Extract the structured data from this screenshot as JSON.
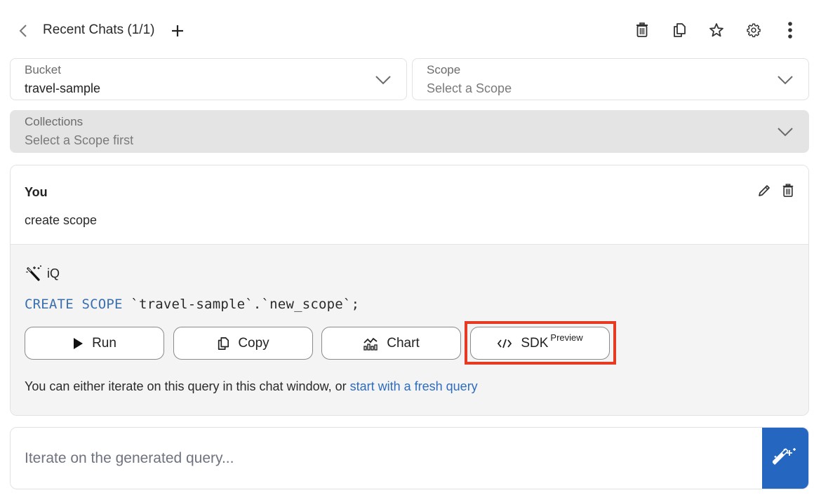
{
  "header": {
    "title": "Recent Chats (1/1)",
    "back_icon": "chevron-left-icon",
    "add_icon": "plus-icon",
    "toolbar": [
      {
        "name": "delete",
        "icon": "trash-icon"
      },
      {
        "name": "copy",
        "icon": "copy-icon"
      },
      {
        "name": "favorite",
        "icon": "star-icon"
      },
      {
        "name": "settings",
        "icon": "gear-icon"
      },
      {
        "name": "more",
        "icon": "more-vertical-icon"
      }
    ]
  },
  "selectors": {
    "bucket": {
      "label": "Bucket",
      "value": "travel-sample"
    },
    "scope": {
      "label": "Scope",
      "placeholder": "Select a Scope"
    },
    "collections": {
      "label": "Collections",
      "placeholder": "Select a Scope first",
      "disabled": true
    }
  },
  "chat": {
    "user": {
      "name": "You",
      "message": "create scope"
    },
    "assistant": {
      "name": "iQ",
      "query_keyword": "CREATE SCOPE",
      "query_rest": " `travel-sample`.`new_scope`;",
      "buttons": {
        "run": "Run",
        "copy": "Copy",
        "chart": "Chart",
        "sdk": "SDK",
        "sdk_badge": "Preview"
      },
      "hint_text": "You can either iterate on this query in this chat window, or ",
      "hint_link": "start with a fresh query"
    }
  },
  "input": {
    "placeholder": "Iterate on the generated query...",
    "value": ""
  },
  "colors": {
    "accent": "#2567c0",
    "link": "#2d6cc0",
    "keyword": "#3a6fae",
    "highlight": "#e63a22"
  }
}
